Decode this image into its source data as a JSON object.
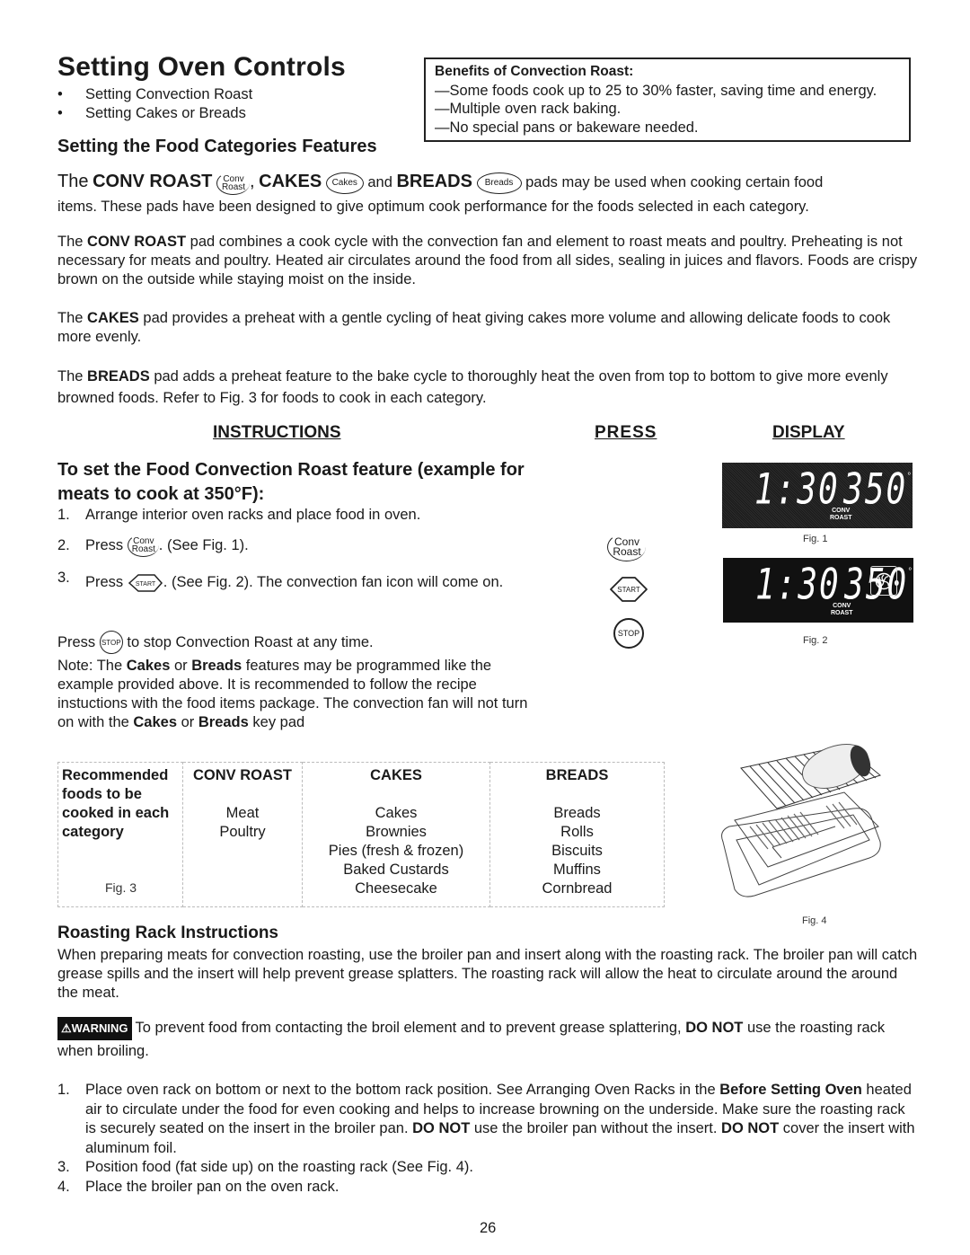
{
  "page": {
    "title": "Setting Oven Controls",
    "bullets": [
      "Setting Convection Roast",
      "Setting Cakes or Breads"
    ],
    "page_number": "26"
  },
  "benefits_box": {
    "heading": "Benefits of Convection Roast:",
    "items": [
      "—Some foods cook up to 25 to 30% faster, saving time and energy.",
      "—Multiple oven rack baking.",
      "—No special pans or bakeware needed."
    ]
  },
  "food_categories": {
    "heading": "Setting the Food Categories Features",
    "intro_the": "The",
    "intro_conv_roast": "CONV ROAST",
    "intro_comma": ",",
    "intro_cakes": "CAKES",
    "intro_and": "and",
    "intro_breads": "BREADS",
    "intro_rest": "pads may be used when cooking certain food",
    "intro_line2": "items. These pads have been designed to give optimum cook performance for the foods selected in each category.",
    "pads": {
      "conv_top": "Conv",
      "conv_bottom": "Roast",
      "cakes": "Cakes",
      "breads": "Breads",
      "start": "START",
      "stop": "STOP"
    },
    "paragraphs": [
      {
        "pre": "The",
        "bold": "CONV ROAST",
        "post": "pad combines a cook cycle with the convection fan and element to roast meats and poultry. Preheating is not necessary for meats and poultry. Heated air circulates around the food from all sides, sealing in juices and flavors. Foods are crispy brown on the outside while staying moist on the inside."
      },
      {
        "pre": "The",
        "bold": "CAKES",
        "post": "pad provides a preheat with a gentle cycling of heat giving cakes more volume and allowing delicate foods to cook more evenly."
      },
      {
        "pre": "The",
        "bold": "BREADS",
        "post": "pad adds a preheat feature to the bake cycle to thoroughly heat the oven from top to bottom to give more evenly browned foods. Refer to Fig. 3 for foods to cook in each category."
      }
    ]
  },
  "instructions": {
    "col_instructions": "INSTRUCTIONS",
    "col_press": "PRESS",
    "col_display": "DISPLAY",
    "subheading": "To set the Food Convection Roast feature (example for meats to cook at 350°F):",
    "steps": [
      {
        "num": "1.",
        "text": "Arrange interior oven racks and place food in oven."
      },
      {
        "num": "2.",
        "pre": "Press",
        "post": ". (See Fig. 1)."
      },
      {
        "num": "3.",
        "pre": "Press",
        "post": ". (See Fig. 2). The convection fan icon will come on."
      }
    ],
    "stop_pre": "Press",
    "stop_post": "to stop Convection Roast at any time.",
    "note": {
      "p1": "Note: The ",
      "b1": "Cakes",
      "p2": " or ",
      "b2": "Breads",
      "p3": " features may be programmed like the example provided above. It is recommended to follow the recipe instuctions with the food items package. The convection fan will not turn on with the ",
      "b3": "Cakes",
      "p4": " or ",
      "b4": "Breads",
      "p5": " key pad"
    }
  },
  "displays": {
    "fig1": {
      "time": "1:30",
      "temp": "350",
      "degree": "°",
      "mode_line1": "CONV",
      "mode_line2": "ROAST",
      "caption": "Fig. 1",
      "fan_icon": false
    },
    "fig2": {
      "time": "1:30",
      "temp": "350",
      "degree": "°",
      "mode_line1": "CONV",
      "mode_line2": "ROAST",
      "caption": "Fig. 2",
      "fan_icon": true
    }
  },
  "food_table": {
    "caption": "Fig. 3",
    "row_header": "Recommended foods to be cooked in each category",
    "columns": [
      {
        "header": "CONV ROAST",
        "items": [
          "Meat",
          "Poultry"
        ]
      },
      {
        "header": "CAKES",
        "items": [
          "Cakes",
          "Brownies",
          "Pies (fresh & frozen)",
          "Baked Custards",
          "Cheesecake"
        ]
      },
      {
        "header": "BREADS",
        "items": [
          "Breads",
          "Rolls",
          "Biscuits",
          "Muffins",
          "Cornbread"
        ]
      }
    ]
  },
  "fig4_caption": "Fig. 4",
  "roasting_rack": {
    "heading": "Roasting Rack Instructions",
    "intro": "When preparing meats for convection roasting, use the broiler pan and insert along with the roasting rack. The broiler pan will catch grease spills and the insert will help prevent grease splatters. The roasting rack will allow the heat to circulate around the around the meat.",
    "warning_label": "WARNING",
    "warning_pre": "To prevent food from contacting the broil element and to prevent grease splattering,",
    "warning_bold": "DO NOT",
    "warning_post": "use the roasting rack when broiling.",
    "steps": [
      {
        "num": "1.",
        "parts": [
          {
            "t": "Place oven rack on bottom or next to the bottom rack position. See Arranging Oven Racks in the ",
            "b": false
          },
          {
            "t": "Before Setting Oven",
            "b": true
          },
          {
            "t": " heated air to circulate under the food for even cooking and helps to increase browning on the underside. Make sure the roasting rack is securely seated on the insert in the broiler pan. ",
            "b": false
          },
          {
            "t": "DO NOT",
            "b": true
          },
          {
            "t": " use the broiler pan without the insert. ",
            "b": false
          },
          {
            "t": "DO NOT",
            "b": true
          },
          {
            "t": " cover the insert with aluminum foil.",
            "b": false
          }
        ]
      },
      {
        "num": "3.",
        "parts": [
          {
            "t": "Position food (fat side up) on the roasting rack (See Fig. 4).",
            "b": false
          }
        ]
      },
      {
        "num": "4.",
        "parts": [
          {
            "t": "Place the broiler pan on the oven rack.",
            "b": false
          }
        ]
      }
    ]
  }
}
